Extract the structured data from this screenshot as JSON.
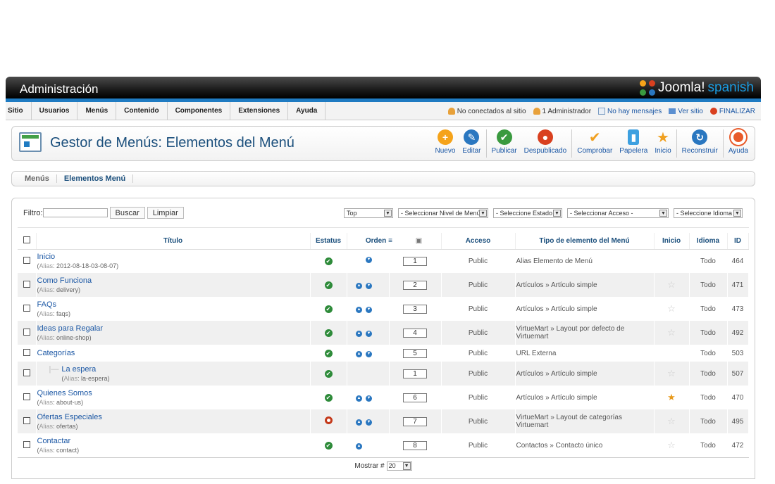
{
  "header": {
    "title": "Administración",
    "logo_text": "Joomla!",
    "logo_sub": "spanish"
  },
  "menubar": {
    "items": [
      "Sitio",
      "Usuarios",
      "Menús",
      "Contenido",
      "Componentes",
      "Extensiones",
      "Ayuda"
    ],
    "status": {
      "visitors": "No conectados al sitio",
      "admins": "1 Administrador",
      "messages": "No hay mensajes",
      "view_site": "Ver sitio",
      "logout": "FINALIZAR"
    }
  },
  "toolbar": {
    "page_title": "Gestor de Menús: Elementos del Menú",
    "buttons": {
      "new": "Nuevo",
      "edit": "Editar",
      "publish": "Publicar",
      "unpublish": "Despublicado",
      "checkin": "Comprobar",
      "trash": "Papelera",
      "home": "Inicio",
      "rebuild": "Reconstruir",
      "help": "Ayuda"
    },
    "colors": {
      "new": "#f5a31a",
      "edit": "#2a77c0",
      "publish": "#3a9a3f",
      "unpublish": "#d9401f",
      "rebuild": "#2a77c0"
    }
  },
  "submenu": {
    "menus": "Menús",
    "items": "Elementos Menú"
  },
  "filters": {
    "label": "Filtro:",
    "search_value": "",
    "search_button": "Buscar",
    "clear_button": "Limpiar",
    "menu_select": "Top",
    "level_select": "- Seleccionar Nivel de Menú -",
    "state_select": "- Seleccione Estado -",
    "access_select": "- Seleccionar Acceso -",
    "language_select": "- Seleccione Idioma -"
  },
  "table": {
    "headers": {
      "title": "Título",
      "status": "Estatus",
      "order": "Orden",
      "access": "Acceso",
      "type": "Tipo de elemento del Menú",
      "home": "Inicio",
      "language": "Idioma",
      "id": "ID"
    },
    "alias_label": "Alias",
    "rows": [
      {
        "title": "Inicio",
        "alias": "2012-08-18-03-08-07",
        "published": true,
        "order": "1",
        "access": "Public",
        "type": "Alias Elemento de Menú",
        "home": "none",
        "language": "Todo",
        "id": "464"
      },
      {
        "title": "Como Funciona",
        "alias": "delivery",
        "published": true,
        "order": "2",
        "access": "Public",
        "type": "Artículos » Artículo simple",
        "home": "off",
        "language": "Todo",
        "id": "471"
      },
      {
        "title": "FAQs",
        "alias": "faqs",
        "published": true,
        "order": "3",
        "access": "Public",
        "type": "Artículos » Artículo simple",
        "home": "off",
        "language": "Todo",
        "id": "473"
      },
      {
        "title": "Ideas para Regalar",
        "alias": "online-shop",
        "published": true,
        "order": "4",
        "access": "Public",
        "type": "VirtueMart » Layout por defecto de Virtuemart",
        "home": "off",
        "language": "Todo",
        "id": "492"
      },
      {
        "title": "Categorías",
        "alias": "",
        "published": true,
        "order": "5",
        "access": "Public",
        "type": "URL Externa",
        "home": "none",
        "language": "Todo",
        "id": "503"
      },
      {
        "title": "La espera",
        "alias": "la-espera",
        "published": true,
        "order": "1",
        "access": "Public",
        "type": "Artículos » Artículo simple",
        "home": "off",
        "language": "Todo",
        "id": "507"
      },
      {
        "title": "Quienes Somos",
        "alias": "about-us",
        "published": true,
        "order": "6",
        "access": "Public",
        "type": "Artículos » Artículo simple",
        "home": "on",
        "language": "Todo",
        "id": "470"
      },
      {
        "title": "Ofertas Especiales",
        "alias": "ofertas",
        "published": false,
        "order": "7",
        "access": "Public",
        "type": "VirtueMart » Layout de categorías Virtuemart",
        "home": "off",
        "language": "Todo",
        "id": "495"
      },
      {
        "title": "Contactar",
        "alias": "contact",
        "published": true,
        "order": "8",
        "access": "Public",
        "type": "Contactos » Contacto único",
        "home": "off",
        "language": "Todo",
        "id": "472"
      }
    ]
  },
  "pagination": {
    "label": "Mostrar #",
    "value": "20"
  }
}
